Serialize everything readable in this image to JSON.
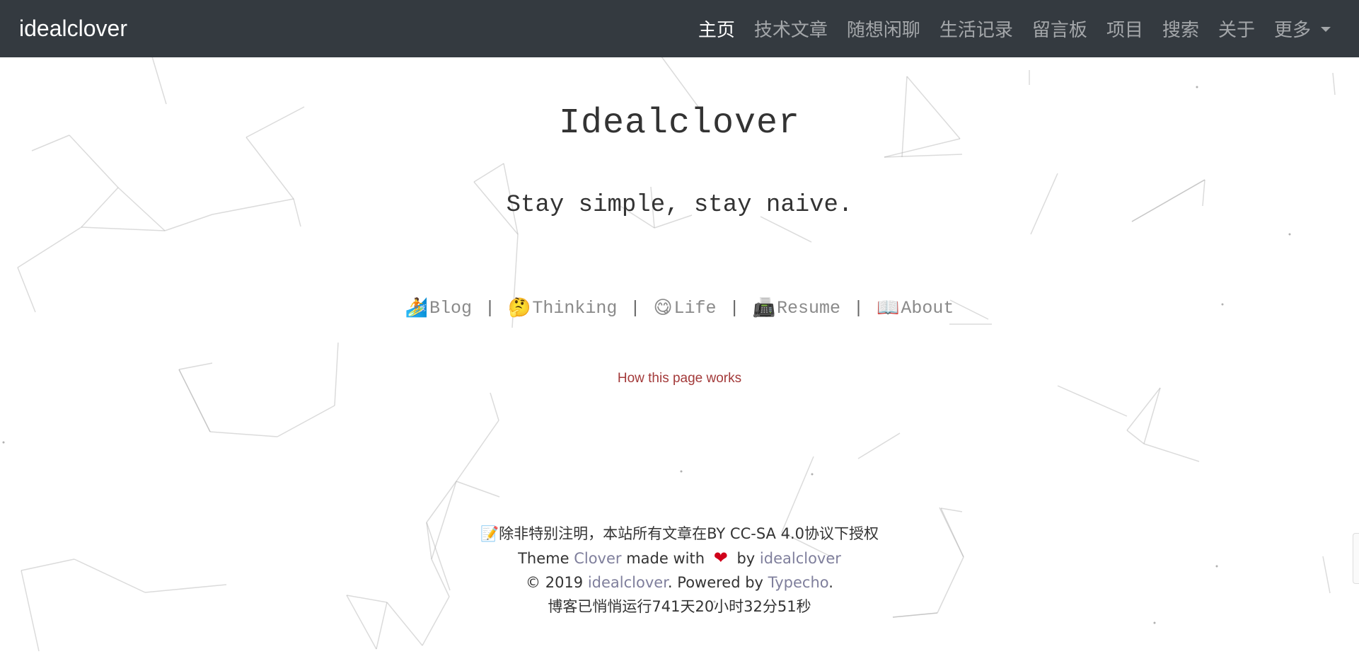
{
  "navbar": {
    "brand": "idealclover",
    "items": [
      {
        "label": "主页",
        "active": true
      },
      {
        "label": "技术文章",
        "active": false
      },
      {
        "label": "随想闲聊",
        "active": false
      },
      {
        "label": "生活记录",
        "active": false
      },
      {
        "label": "留言板",
        "active": false
      },
      {
        "label": "项目",
        "active": false
      },
      {
        "label": "搜索",
        "active": false
      },
      {
        "label": "关于",
        "active": false
      },
      {
        "label": "更多",
        "active": false,
        "dropdown": true
      }
    ]
  },
  "hero": {
    "title": "Idealclover",
    "tagline": "Stay simple, stay naive.",
    "links": [
      {
        "emoji": "🏄",
        "label": "Blog"
      },
      {
        "emoji": "🤔",
        "label": "Thinking"
      },
      {
        "emoji": "😋",
        "label": "Life"
      },
      {
        "emoji": "📠",
        "label": "Resume"
      },
      {
        "emoji": "📖",
        "label": "About"
      }
    ],
    "separator": "|",
    "how_link": "How this page works"
  },
  "footer": {
    "license_emoji": "📝",
    "license": "除非特别注明，本站所有文章在BY CC-SA 4.0协议下授权",
    "theme_prefix": "Theme ",
    "theme_name": "Clover",
    "theme_mid": " made with ",
    "theme_heart": "❤",
    "theme_by": " by ",
    "theme_author": "idealclover",
    "copyright_prefix": "© 2019 ",
    "copyright_name": "idealclover",
    "powered_text": ". Powered by ",
    "powered_name": "Typecho",
    "powered_suffix": ".",
    "uptime": "博客已悄悄运行741天20小时32分51秒"
  },
  "colors": {
    "navbar_bg": "#343a40",
    "link_gray": "#8a8a8a",
    "how_link": "#a33a3a",
    "footer_link": "#7f7f9c",
    "heart": "#d0021b"
  }
}
